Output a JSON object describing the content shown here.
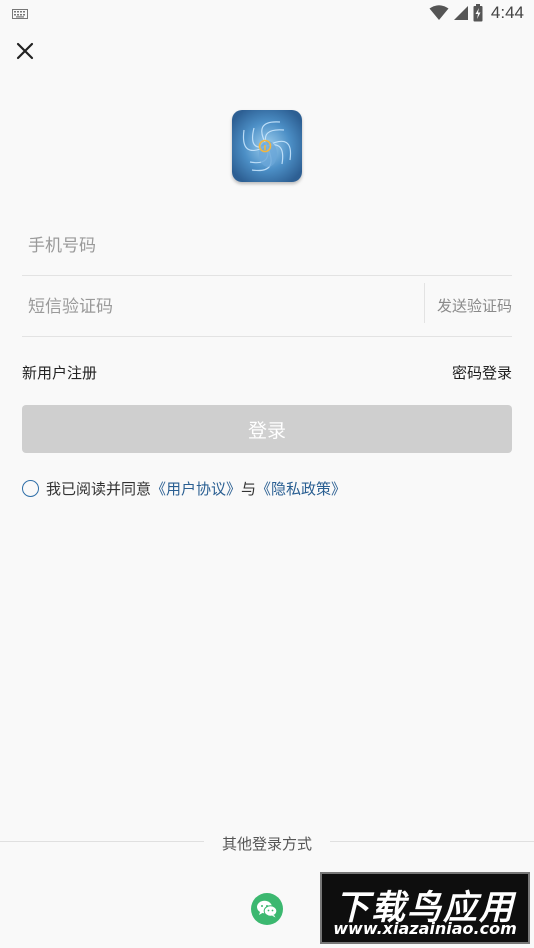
{
  "status_bar": {
    "time": "4:44"
  },
  "form": {
    "phone_placeholder": "手机号码",
    "sms_placeholder": "短信验证码",
    "send_code_label": "发送验证码",
    "register_label": "新用户注册",
    "password_login_label": "密码登录",
    "login_label": "登录"
  },
  "agreement": {
    "prefix": "我已阅读并同意",
    "user_agreement": "《用户协议》",
    "joiner": "与",
    "privacy_policy": "《隐私政策》"
  },
  "other_login": {
    "title": "其他登录方式"
  },
  "watermark": {
    "line1": "下载鸟应用",
    "line2": "www.xiazainiao.com"
  },
  "colors": {
    "accent": "#2a5f92",
    "login_button_disabled": "#cfcfcf",
    "wechat": "#3cb870"
  }
}
